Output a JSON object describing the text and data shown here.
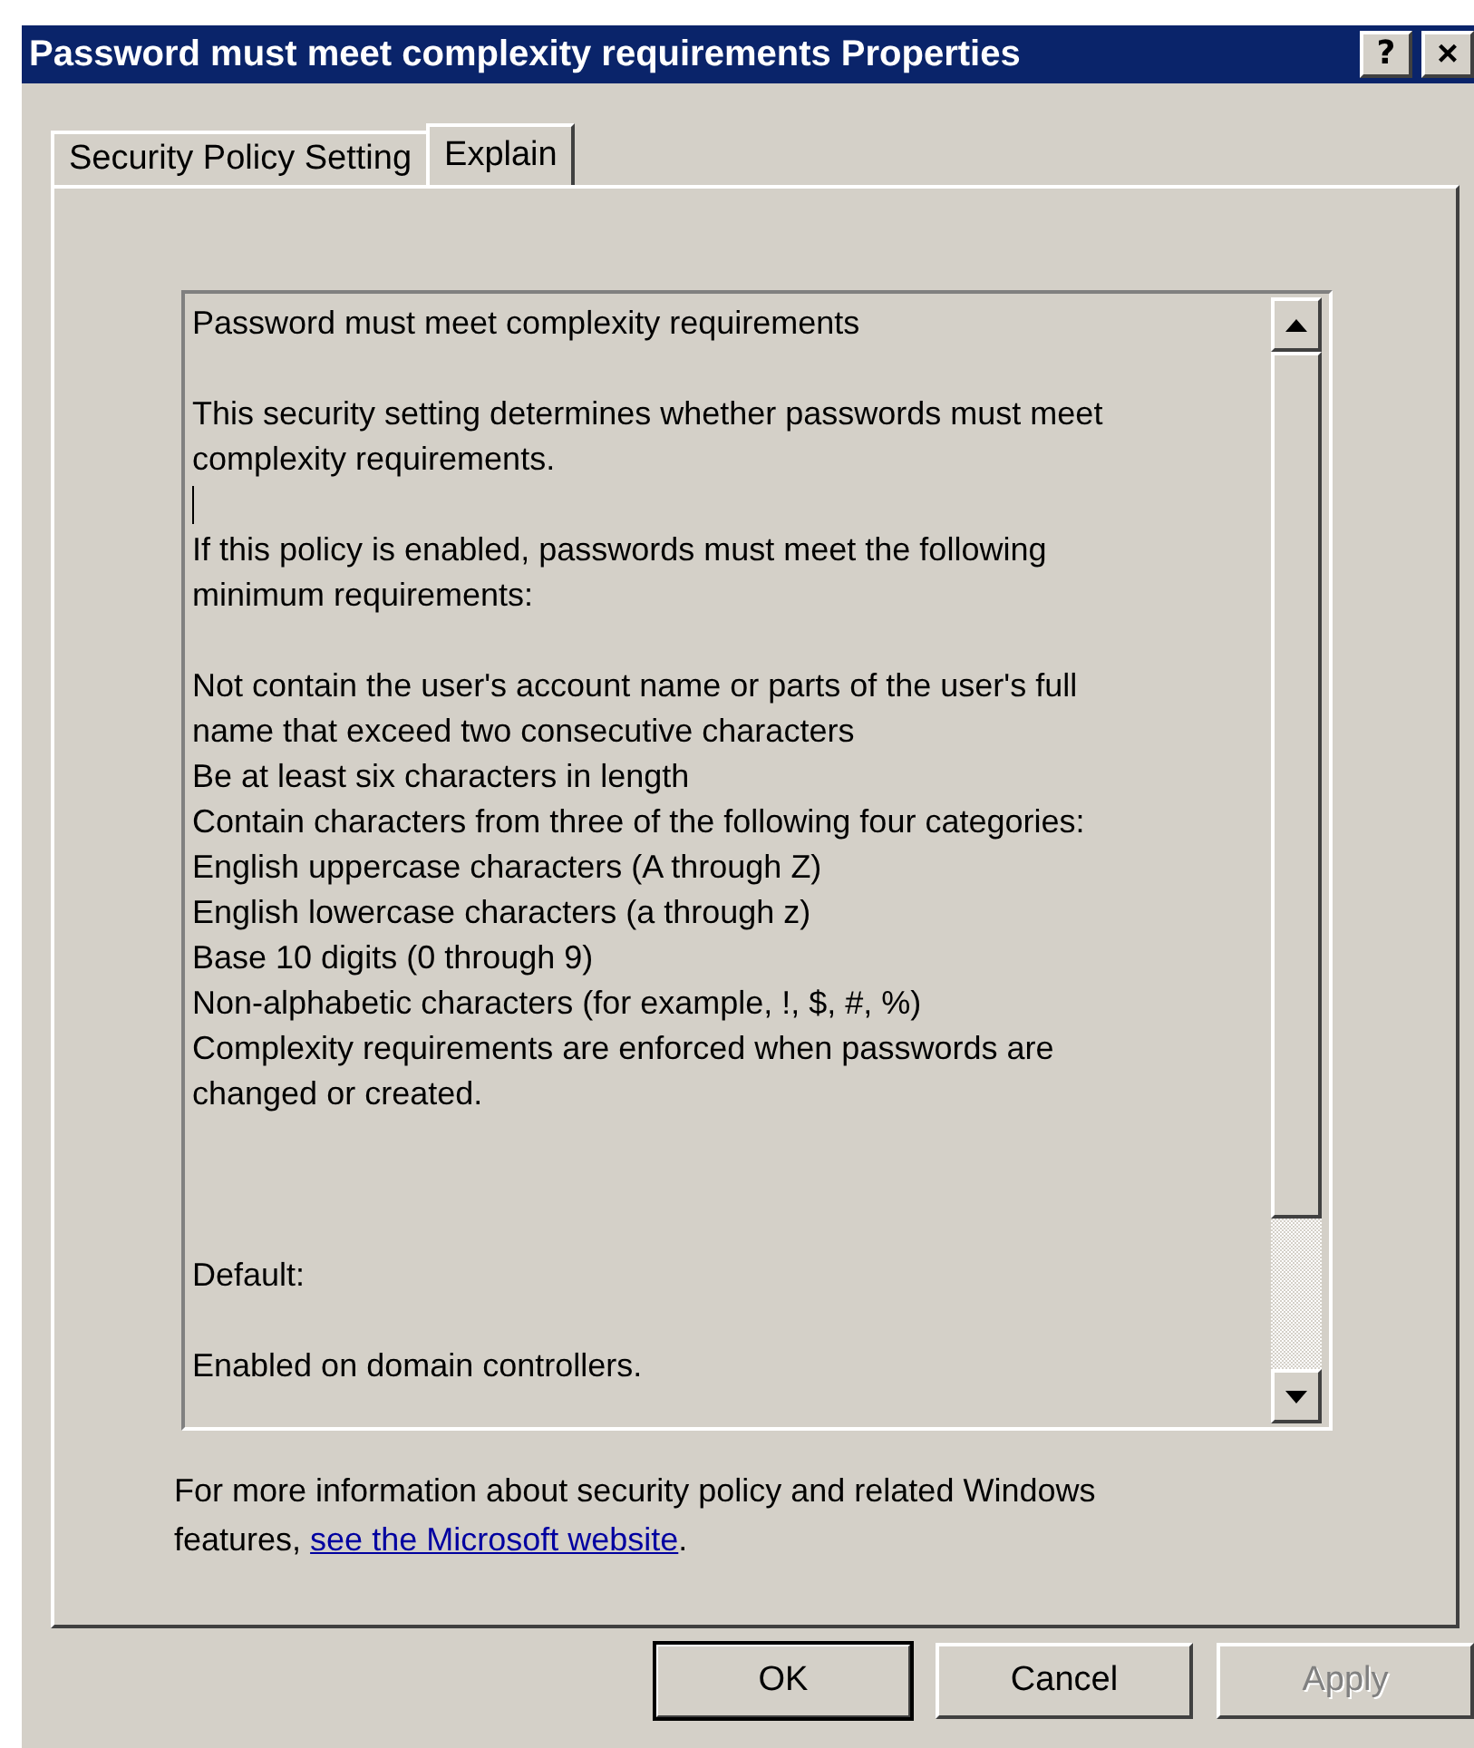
{
  "window": {
    "title": "Password must meet complexity requirements Properties",
    "buttons": [
      {
        "kind": "help",
        "label": "?"
      },
      {
        "kind": "close",
        "label": "×"
      }
    ]
  },
  "tabs": [
    {
      "label": "Security Policy Setting",
      "selected": false
    },
    {
      "label": "Explain",
      "selected": true
    }
  ],
  "explain": {
    "lines": [
      {
        "kind": "text",
        "text": "Password must meet complexity requirements"
      },
      {
        "kind": "blank",
        "caret": false
      },
      {
        "kind": "text",
        "text": "This security setting determines whether passwords must meet"
      },
      {
        "kind": "text",
        "text": "complexity requirements."
      },
      {
        "kind": "blank",
        "caret": true
      },
      {
        "kind": "text",
        "text": "If this policy is enabled, passwords must meet the following"
      },
      {
        "kind": "text",
        "text": "minimum requirements:"
      },
      {
        "kind": "blank",
        "caret": false
      },
      {
        "kind": "text",
        "text": "Not contain the user's account name or parts of the user's full"
      },
      {
        "kind": "text",
        "text": "name that exceed two consecutive characters"
      },
      {
        "kind": "text",
        "text": "Be at least six characters in length"
      },
      {
        "kind": "text",
        "text": "Contain characters from three of the following four categories:"
      },
      {
        "kind": "text",
        "text": "English uppercase characters (A through Z)"
      },
      {
        "kind": "text",
        "text": "English lowercase characters (a through z)"
      },
      {
        "kind": "text",
        "text": "Base 10 digits (0 through 9)"
      },
      {
        "kind": "text",
        "text": "Non-alphabetic characters (for example, !, $, #, %)"
      },
      {
        "kind": "text",
        "text": "Complexity requirements are enforced when passwords are"
      },
      {
        "kind": "text",
        "text": "changed or created."
      },
      {
        "kind": "blank",
        "caret": false
      },
      {
        "kind": "blank",
        "caret": false
      },
      {
        "kind": "blank",
        "caret": false
      },
      {
        "kind": "text",
        "text": "Default:"
      },
      {
        "kind": "blank",
        "caret": false
      },
      {
        "kind": "text",
        "text": "Enabled on domain controllers."
      }
    ]
  },
  "info": {
    "lines": [
      "For more information about security policy and related Windows"
    ],
    "prefix": "features, ",
    "link": "see the Microsoft website",
    "suffix": "."
  },
  "buttons": [
    {
      "label": "OK",
      "default": true,
      "disabled": false
    },
    {
      "label": "Cancel",
      "default": false,
      "disabled": false
    },
    {
      "label": "Apply",
      "default": false,
      "disabled": true
    }
  ]
}
